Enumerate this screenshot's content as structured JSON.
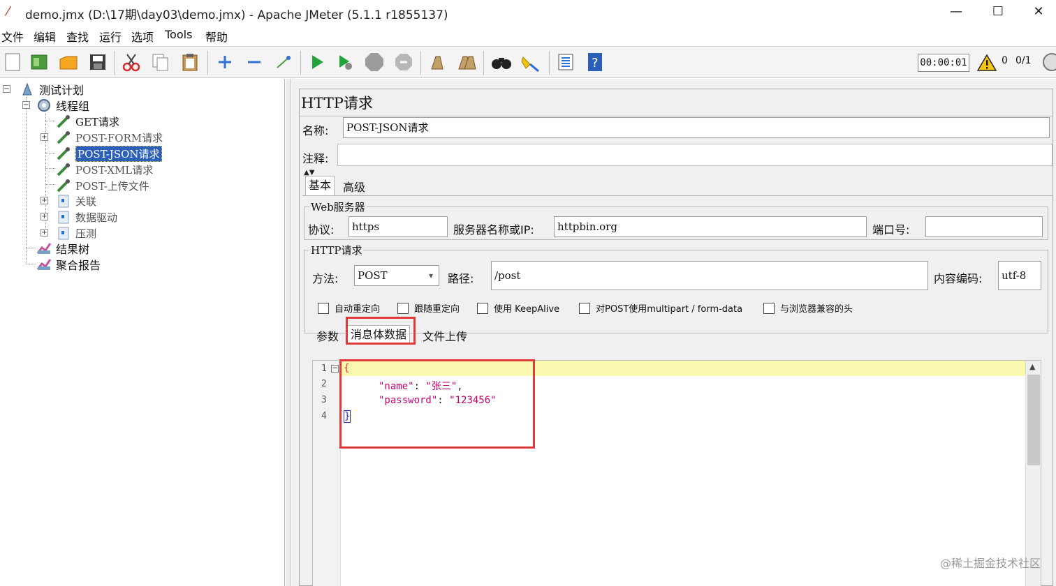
{
  "window": {
    "title": "demo.jmx (D:\\17期\\day03\\demo.jmx) - Apache JMeter (5.1.1 r1855137)",
    "minimize": "—",
    "maximize": "☐",
    "close": "✕"
  },
  "menu": [
    "文件",
    "编辑",
    "查找",
    "运行",
    "选项",
    "Tools",
    "帮助"
  ],
  "toolbar": {
    "icons": [
      "new-icon",
      "templates-icon",
      "open-icon",
      "save-icon",
      "cut-icon",
      "copy-icon",
      "paste-icon",
      "expand-icon",
      "collapse-icon",
      "toggle-icon",
      "start-icon",
      "start-no-pauses-icon",
      "stop-icon",
      "shutdown-icon",
      "clear-icon",
      "clear-all-icon",
      "search-icon",
      "reset-search-icon",
      "function-helper-icon",
      "help-icon"
    ],
    "timer": "00:00:01",
    "warnings": "0",
    "threads": "0/1"
  },
  "tree": {
    "items": [
      {
        "label": "测试计划"
      },
      {
        "label": "线程组"
      },
      {
        "label": "GET请求"
      },
      {
        "label": "POST-FORM请求"
      },
      {
        "label": "POST-JSON请求"
      },
      {
        "label": "POST-XML请求"
      },
      {
        "label": "POST-上传文件"
      },
      {
        "label": "关联"
      },
      {
        "label": "数据驱动"
      },
      {
        "label": "压测"
      },
      {
        "label": "结果树"
      },
      {
        "label": "聚合报告"
      }
    ]
  },
  "panel": {
    "title": "HTTP请求",
    "name_label": "名称:",
    "name_value": "POST-JSON请求",
    "comment_label": "注释:",
    "comment_value": "",
    "tabs": [
      "基本",
      "高级"
    ],
    "web_server": {
      "group_title": "Web服务器",
      "protocol_label": "协议:",
      "protocol_value": "https",
      "server_label": "服务器名称或IP:",
      "server_value": "httpbin.org",
      "port_label": "端口号:",
      "port_value": ""
    },
    "http_request": {
      "group_title": "HTTP请求",
      "method_label": "方法:",
      "method_value": "POST",
      "path_label": "路径:",
      "path_value": "/post",
      "encoding_label": "内容编码:",
      "encoding_value": "utf-8"
    },
    "checkboxes": [
      "自动重定向",
      "跟随重定向",
      "使用 KeepAlive",
      "对POST使用multipart / form-data",
      "与浏览器兼容的头"
    ],
    "body_tabs": [
      "参数",
      "消息体数据",
      "文件上传"
    ],
    "editor": {
      "line_numbers": [
        "1",
        "2",
        "3",
        "4"
      ],
      "open_brace": "{",
      "key1": "\"name\"",
      "val1": "\"张三\"",
      "key2": "\"password\"",
      "val2": "\"123456\"",
      "close_brace": "}",
      "colon": ": ",
      "comma": ","
    }
  },
  "watermark": "@稀土掘金技术社区"
}
